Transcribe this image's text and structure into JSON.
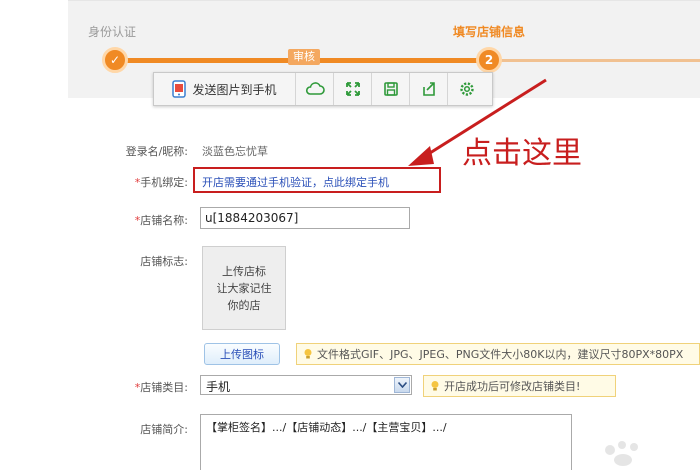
{
  "progress": {
    "step1_label": "身份认证",
    "step1_mark": "✓",
    "audit_label": "审核",
    "step2_number": "2",
    "step2_label": "填写店铺信息"
  },
  "toolbar": {
    "send_label": "发送图片到手机",
    "icons": [
      "cloud-icon",
      "fullscreen-icon",
      "save-icon",
      "share-icon",
      "settings-icon"
    ]
  },
  "form": {
    "login_label": "登录名/昵称:",
    "login_value": "淡蓝色忘忧草",
    "phone_label": "手机绑定:",
    "phone_link": "开店需要通过手机验证，点此绑定手机",
    "store_name_label": "店铺名称:",
    "store_name_value": "u[1884203067]",
    "store_logo_label": "店铺标志:",
    "logo_line1": "上传店标",
    "logo_line2": "让大家记住",
    "logo_line3": "你的店",
    "upload_button": "上传图标",
    "file_hint": "文件格式GIF、JPG、JPEG、PNG文件大小80K以内，建议尺寸80PX*80PX",
    "category_label": "店铺类目:",
    "category_value": "手机",
    "category_hint": "开店成功后可修改店铺类目!",
    "intro_label": "店铺简介:",
    "intro_value": "【掌柜签名】.../【店铺动态】.../【主营宝贝】.../",
    "required_mark": "*"
  },
  "annotation": {
    "text": "点击这里"
  },
  "colors": {
    "accent_orange": "#f08a24",
    "annotation_red": "#c81e1e",
    "link_blue": "#2a4fb8"
  }
}
